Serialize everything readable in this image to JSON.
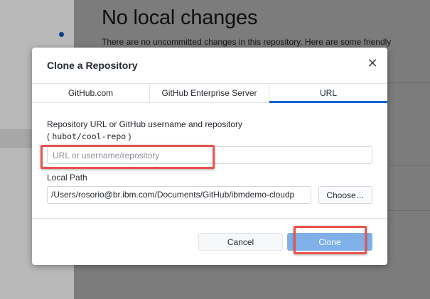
{
  "background": {
    "title": "No local changes",
    "subtitle": "There are no uncommitted changes in this repository. Here are some friendly"
  },
  "dialog": {
    "title": "Clone a Repository",
    "close_icon": "close-icon",
    "close_glyph": "✕",
    "tabs": [
      {
        "label": "GitHub.com",
        "active": false
      },
      {
        "label": "GitHub Enterprise Server",
        "active": false
      },
      {
        "label": "URL",
        "active": true
      }
    ],
    "url_label": "Repository URL or GitHub username and repository",
    "url_example_open": "(",
    "url_example_mono": "hubot/cool-repo",
    "url_example_close": ")",
    "url_input": {
      "value": "",
      "placeholder": "URL or username/repository"
    },
    "local_path_label": "Local Path",
    "local_path_value": "/Users/rosorio@br.ibm.com/Documents/GitHub/ibmdemo-cloudp",
    "choose_label": "Choose…",
    "cancel_label": "Cancel",
    "clone_label": "Clone"
  },
  "colors": {
    "accent": "#0366d6",
    "clone_button": "#7fb0e8",
    "annotation": "#e9544e"
  }
}
